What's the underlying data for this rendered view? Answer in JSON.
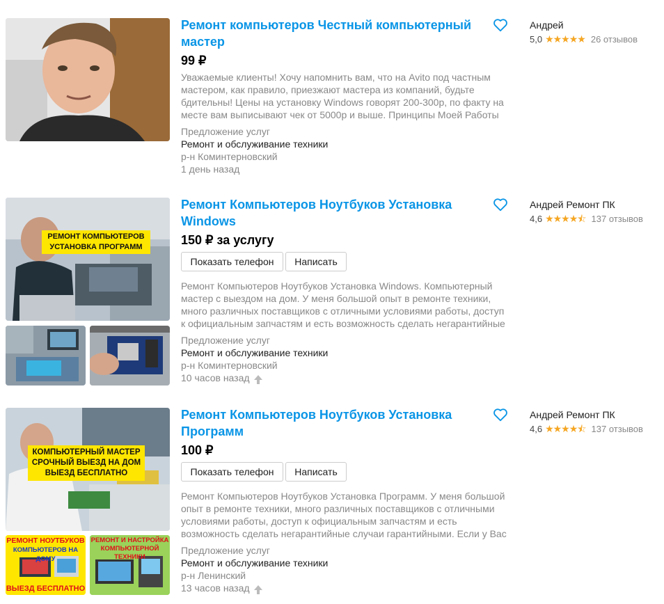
{
  "listings": [
    {
      "title": "Ремонт компьютеров Честный компьютерный мастер",
      "price": "99 ₽",
      "description": "Уважаемые клиенты! Хочу напомнить вам, что на Avito под частным мастером, как правило, приезжают мастера из компаний, будьте бдительны! Цены на установку Windows говорят 200-300р, по факту на месте вам выписывают чек от 5000р и выше. Принципы Моей Работы",
      "category": "Предложение услуг",
      "subcategory": "Ремонт и обслуживание техники",
      "district": "р-н Коминтерновский",
      "time": "1 день назад",
      "seller": "Андрей",
      "rating": "5,0",
      "stars": "★★★★★",
      "reviews": "26 отзывов"
    },
    {
      "title": "Ремонт Компьютеров Ноутбуков Установка Windows",
      "price": "150 ₽ за услугу",
      "show_phone": "Показать телефон",
      "write": "Написать",
      "description": "Ремонт Компьютеров Ноутбуков Установка Windows. Компьютерный мастер с выездом на дом. У меня большой опыт в ремонте техники, много различных поставщиков с отличными условиями работы, доступ к официальным запчастям и есть возможность сделать негарантийные",
      "category": "Предложение услуг",
      "subcategory": "Ремонт и обслуживание техники",
      "district": "р-н Коминтерновский",
      "time": "10 часов назад",
      "seller": "Андрей Ремонт ПК",
      "rating": "4,6",
      "stars": "★★★★⯪",
      "reviews": "137 отзывов",
      "photo_sign": [
        "РЕМОНТ КОМПЬЮТЕРОВ",
        "УСТАНОВКА ПРОГРАММ"
      ]
    },
    {
      "title": "Ремонт Компьютеров Ноутбуков Установка Программ",
      "price": "100 ₽",
      "show_phone": "Показать телефон",
      "write": "Написать",
      "description": "Ремонт Компьютеров Ноутбуков Установка Программ. У меня большой опыт в ремонте техники, много различных поставщиков с отличными условиями работы, доступ к официальным запчастям и есть возможность сделать негарантийные случаи гарантийными. Если у Вас",
      "category": "Предложение услуг",
      "subcategory": "Ремонт и обслуживание техники",
      "district": "р-н Ленинский",
      "time": "13 часов назад",
      "seller": "Андрей Ремонт ПК",
      "rating": "4,6",
      "stars": "★★★★⯪",
      "reviews": "137 отзывов",
      "photo_sign": [
        "КОМПЬЮТЕРНЫЙ МАСТЕР",
        "СРОЧНЫЙ ВЫЕЗД НА ДОМ",
        "ВЫЕЗД БЕСПЛАТНО"
      ],
      "thumb1_sign": [
        "РЕМОНТ НОУТБУКОВ",
        "КОМПЬЮТЕРОВ НА ДОМУ",
        "ВЫЕЗД БЕСПЛАТНО"
      ],
      "thumb2_sign": [
        "РЕМОНТ И НАСТРОЙКА",
        "КОМПЬЮТЕРНОЙ ТЕХНИКИ"
      ]
    }
  ],
  "colors": {
    "link": "#0a95e6",
    "star": "#f5a623",
    "sign": "#ffe600"
  },
  "icons": {
    "favorite": "heart-icon",
    "raised": "arrow-up-icon"
  }
}
